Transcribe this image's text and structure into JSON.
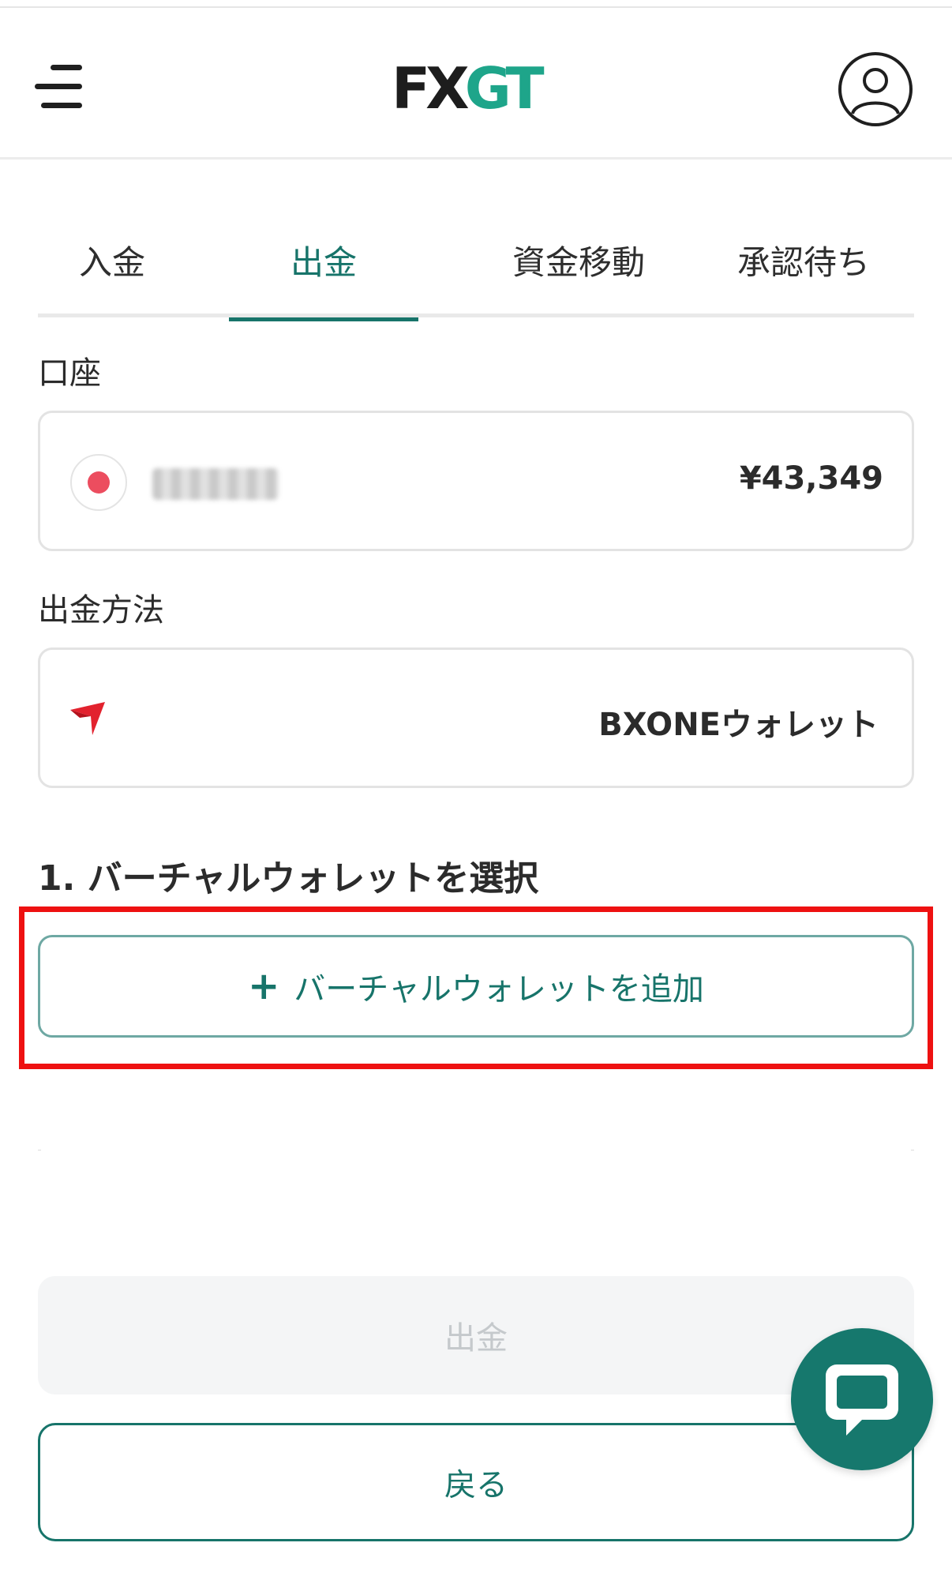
{
  "header": {
    "logo_fx": "FX",
    "logo_gt": "GT",
    "menu_icon": "menu-icon",
    "profile_icon": "user-circle-icon"
  },
  "tabs": [
    {
      "label": "入金",
      "active": false
    },
    {
      "label": "出金",
      "active": true
    },
    {
      "label": "資金移動",
      "active": false
    },
    {
      "label": "承認待ち",
      "active": false
    }
  ],
  "account": {
    "label": "口座",
    "balance": "¥43,349",
    "flag_icon": "japan-flag-icon"
  },
  "method": {
    "label": "出金方法",
    "name": "BXONEウォレット",
    "logo_icon": "bxone-logo-icon"
  },
  "step": {
    "title": "1. バーチャルウォレットを選択",
    "add_label": "バーチャルウォレットを追加",
    "add_icon": "plus-icon"
  },
  "actions": {
    "withdraw_label": "出金",
    "back_label": "戻る",
    "chat_icon": "chat-bubble-icon"
  },
  "colors": {
    "accent": "#17746a",
    "highlight": "#ee1111",
    "logo_green": "#1ea58a"
  }
}
